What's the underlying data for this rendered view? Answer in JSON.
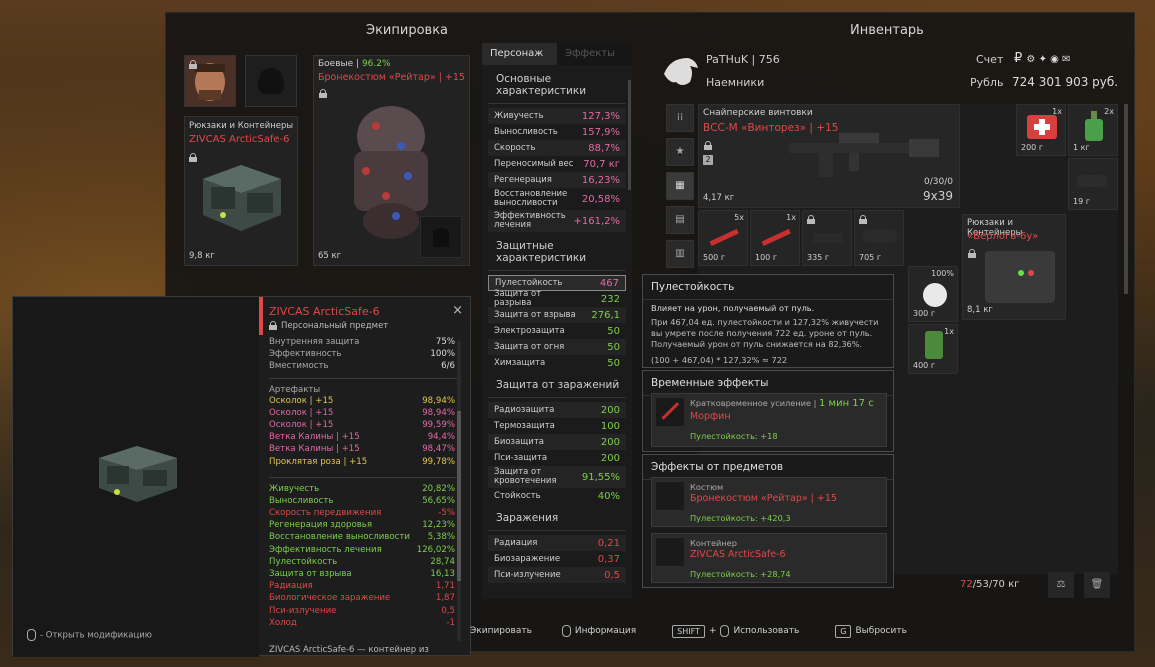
{
  "headers": {
    "equipment": "Экипировка",
    "inventory": "Инвентарь"
  },
  "equipment": {
    "backpack_label": "Рюкзаки и Контейнеры",
    "backpack_name": "ZIVCAS ArcticSafe-6",
    "backpack_weight": "9,8 кг",
    "armor_category": "Боевые",
    "armor_percent": "96.2%",
    "armor_name": "Бронекостюм «Рейтар»",
    "armor_level": "+15",
    "armor_weight": "65 кг"
  },
  "stats": {
    "tabs": [
      "Персонаж",
      "Эффекты"
    ],
    "sections": [
      {
        "title": "Основные характеристики",
        "rows": [
          {
            "label": "Живучесть",
            "value": "127,3%",
            "color": "pink"
          },
          {
            "label": "Выносливость",
            "value": "157,9%",
            "color": "pink"
          },
          {
            "label": "Скорость",
            "value": "88,7%",
            "color": "pink"
          },
          {
            "label": "Переносимый вес",
            "value": "70,7 кг",
            "color": "pink"
          },
          {
            "label": "Регенерация",
            "value": "16,23%",
            "color": "pink"
          },
          {
            "label": "Восстановление выносливости",
            "value": "20,58%",
            "color": "pink",
            "tall": true
          },
          {
            "label": "Эффективность лечения",
            "value": "+161,2%",
            "color": "pink",
            "tall": true
          }
        ]
      },
      {
        "title": "Защитные характеристики",
        "rows": [
          {
            "label": "Пулестойкость",
            "value": "467",
            "color": "pink",
            "hl": true
          },
          {
            "label": "Защита от разрыва",
            "value": "232",
            "color": "green"
          },
          {
            "label": "Защита от взрыва",
            "value": "276,1",
            "color": "green"
          },
          {
            "label": "Электрозащита",
            "value": "50",
            "color": "green"
          },
          {
            "label": "Защита от огня",
            "value": "50",
            "color": "green"
          },
          {
            "label": "Химзащита",
            "value": "50",
            "color": "green"
          }
        ]
      },
      {
        "title": "Защита от заражений",
        "rows": [
          {
            "label": "Радиозащита",
            "value": "200",
            "color": "green"
          },
          {
            "label": "Термозащита",
            "value": "100",
            "color": "green"
          },
          {
            "label": "Биозащита",
            "value": "200",
            "color": "green"
          },
          {
            "label": "Пси-защита",
            "value": "200",
            "color": "green"
          },
          {
            "label": "Защита от кровотечения",
            "value": "91,55%",
            "color": "green",
            "tall": true
          },
          {
            "label": "Стойкость",
            "value": "40%",
            "color": "green"
          }
        ]
      },
      {
        "title": "Заражения",
        "rows": [
          {
            "label": "Радиация",
            "value": "0,21",
            "color": "red"
          },
          {
            "label": "Биозаражение",
            "value": "0,37",
            "color": "red"
          },
          {
            "label": "Пси-излучение",
            "value": "0,5",
            "color": "red"
          }
        ]
      }
    ]
  },
  "profile": {
    "name": "PaTHuK",
    "level": "756",
    "faction": "Наемники",
    "account_label": "Счет",
    "currency_label": "Рубль",
    "balance": "724 301 903 руб."
  },
  "inventory": {
    "weapon_category": "Снайперские винтовки",
    "weapon_name": "ВСС-М «Винторез»",
    "weapon_level": "+15",
    "weapon_weight": "4,17 кг",
    "weapon_ammo": "0/30/0",
    "weapon_caliber": "9x39",
    "container_category": "Рюкзаки и Контейнеры",
    "container_name": "«Берлога-6у»",
    "container_weight": "8,1 кг",
    "items": [
      {
        "count": "1x",
        "weight": "200 г"
      },
      {
        "count": "2x",
        "weight": "1 кг"
      },
      {
        "count": "",
        "weight": "19 г"
      },
      {
        "count": "5x",
        "weight": "500 г"
      },
      {
        "count": "1x",
        "weight": "100 г"
      },
      {
        "count": "",
        "weight": "335 г"
      },
      {
        "count": "",
        "weight": "705 г"
      },
      {
        "count": "100%",
        "weight": "300 г"
      },
      {
        "count": "1x",
        "weight": "400 г"
      }
    ],
    "capacity_current": "72",
    "capacity_rest": "/53/70 кг"
  },
  "tooltip": {
    "title": "Пулестойкость",
    "subtitle": "Влияет на урон, получаемый от пуль.",
    "desc": "При 467,04 ед. пулестойкости и 127,32% живучести вы умрете после получения 722 ед. уроне от пуль. Получаемый урон от пуль снижается на 82,36%.",
    "formula": "(100 + 467,04) * 127,32% ≈ 722",
    "temp_title": "Временные эффекты",
    "temp_effect_label": "Кратковременное усиление |",
    "temp_effect_time": "1 мин 17 с",
    "temp_effect_name": "Морфин",
    "temp_effect_bonus": "Пулестойкость: +18",
    "items_title": "Эффекты от предметов",
    "item1_type": "Костюм",
    "item1_name": "Бронекостюм «Рейтар» | +15",
    "item1_bonus": "Пулестойкость: +420,3",
    "item2_type": "Контейнер",
    "item2_name": "ZIVCAS ArcticSafe-6",
    "item2_bonus": "Пулестойкость: +28,74"
  },
  "left_panel": {
    "title": "ZIVCAS ArcticSafe-6",
    "subtitle": "Персональный предмет",
    "rows_top": [
      {
        "label": "Внутренняя защита",
        "value": "75%"
      },
      {
        "label": "Эффективность",
        "value": "100%"
      },
      {
        "label": "Вместимость",
        "value": "6/6"
      }
    ],
    "artifacts_title": "Артефакты",
    "artifacts": [
      {
        "label": "Осколок | +15",
        "value": "98,94%",
        "color": "yellow"
      },
      {
        "label": "Осколок | +15",
        "value": "98,94%",
        "color": "pink"
      },
      {
        "label": "Осколок | +15",
        "value": "99,59%",
        "color": "pink"
      },
      {
        "label": "Ветка Калины | +15",
        "value": "94,4%",
        "color": "pink"
      },
      {
        "label": "Ветка Калины | +15",
        "value": "98,47%",
        "color": "pink"
      },
      {
        "label": "Проклятая роза | +15",
        "value": "99,78%",
        "color": "yellow"
      }
    ],
    "effects": [
      {
        "label": "Живучесть",
        "value": "20,82%",
        "color": "green"
      },
      {
        "label": "Выносливость",
        "value": "56,65%",
        "color": "green"
      },
      {
        "label": "Скорость передвижения",
        "value": "-5%",
        "color": "red"
      },
      {
        "label": "Регенерация здоровья",
        "value": "12,23%",
        "color": "green"
      },
      {
        "label": "Восстановление выносливости",
        "value": "5,38%",
        "color": "green"
      },
      {
        "label": "Эффективность лечения",
        "value": "126,02%",
        "color": "green"
      },
      {
        "label": "Пулестойкость",
        "value": "28,74",
        "color": "green"
      },
      {
        "label": "Защита от взрыва",
        "value": "16,13",
        "color": "green"
      },
      {
        "label": "Радиация",
        "value": "1,71",
        "color": "red"
      },
      {
        "label": "Биологическое заражение",
        "value": "1,87",
        "color": "red"
      },
      {
        "label": "Пси-излучение",
        "value": "0,5",
        "color": "red"
      },
      {
        "label": "Холод",
        "value": "-1",
        "color": "red"
      }
    ],
    "footer_desc": "ZIVCAS ArcticSafe-6 — контейнер из",
    "open_mod": "- Открыть модификацию"
  },
  "bottombar": {
    "equip": "Экипировать",
    "info": "Информация",
    "shift_key": "SHIFT",
    "plus": "+",
    "use": "Использовать",
    "g_key": "G",
    "drop": "Выбросить"
  },
  "colors": {
    "accent_red": "#e04848",
    "green": "#7ccf4a",
    "pink": "#e06aa6",
    "yellow": "#e0c650"
  }
}
